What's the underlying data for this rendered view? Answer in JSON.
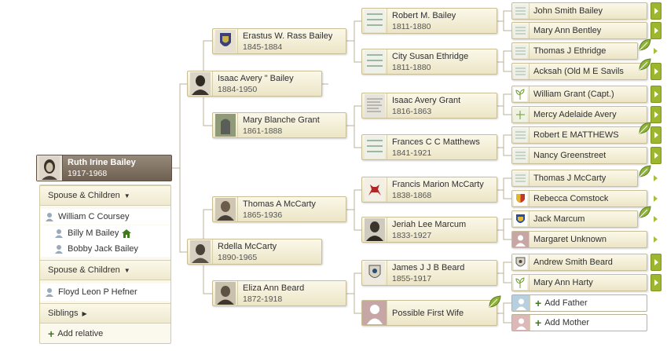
{
  "focus": {
    "name": "Ruth Irine Bailey",
    "dates": "1917-1968"
  },
  "panel": {
    "spouse1_header": "Spouse & Children",
    "spouse1": "William C Coursey",
    "children1": [
      "Billy M Bailey",
      "Bobby Jack Bailey"
    ],
    "spouse2_header": "Spouse & Children",
    "spouse2": "Floyd Leon P Hefner",
    "siblings": "Siblings",
    "add_relative": "Add relative"
  },
  "parents": {
    "father": {
      "name": "Isaac Avery \" Bailey",
      "dates": "1884-1950"
    },
    "mother": {
      "name": "Rdella McCarty",
      "dates": "1890-1965"
    }
  },
  "grandparents": [
    {
      "name": "Erastus W. Rass Bailey",
      "dates": "1845-1884"
    },
    {
      "name": "Mary Blanche Grant",
      "dates": "1861-1888"
    },
    {
      "name": "Thomas A McCarty",
      "dates": "1865-1936"
    },
    {
      "name": "Eliza Ann Beard",
      "dates": "1872-1918"
    }
  ],
  "great_grandparents": [
    {
      "name": "Robert M. Bailey",
      "dates": "1811-1880"
    },
    {
      "name": "City Susan Ethridge",
      "dates": "1811-1880"
    },
    {
      "name": "Isaac Avery Grant",
      "dates": "1816-1863"
    },
    {
      "name": "Frances C C Matthews",
      "dates": "1841-1921"
    },
    {
      "name": "Francis Marion McCarty",
      "dates": "1838-1868"
    },
    {
      "name": "Jeriah Lee Marcum",
      "dates": "1833-1927"
    },
    {
      "name": "James J J B Beard",
      "dates": "1855-1917"
    },
    {
      "name": "Possible First Wife",
      "dates": ""
    }
  ],
  "gen4": [
    "John Smith Bailey",
    "Mary Ann Bentley",
    "Thomas J Ethridge",
    "Acksah (Old M E Savils",
    "William Grant (Capt.)",
    "Mercy Adelaide Avery",
    "Robert E MATTHEWS",
    "Nancy Greenstreet",
    "Thomas J McCarty",
    "Rebecca Comstock",
    "Jack Marcum",
    "Margaret Unknown",
    "Andrew Smith Beard",
    "Mary Ann Harty"
  ],
  "add_parents": {
    "father": "Add Father",
    "mother": "Add Mother"
  },
  "colors": {
    "card_bg": "#f3eed6",
    "card_border": "#c8bf98",
    "accent_green": "#9db62f",
    "focus_bg": "#7d6f60"
  }
}
